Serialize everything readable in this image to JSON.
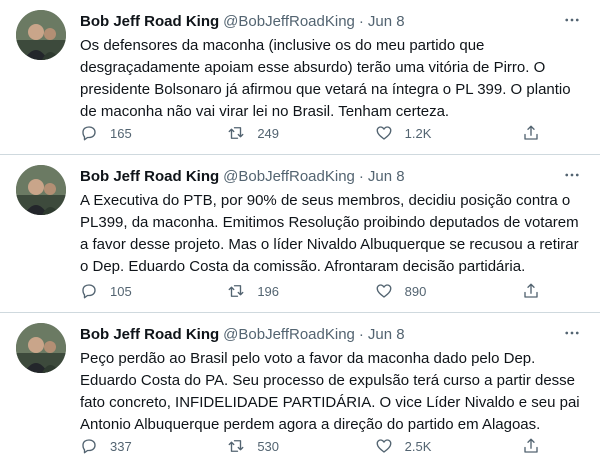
{
  "icons": {
    "more": "more-horizontal-icon",
    "reply": "reply-icon",
    "retweet": "retweet-icon",
    "like": "heart-icon",
    "share": "share-icon"
  },
  "colors": {
    "text": "#0f1419",
    "secondary": "#536471",
    "divider": "#cfd9de"
  },
  "tweets": [
    {
      "name": "Bob Jeff Road King",
      "handle": "@BobJeffRoadKing",
      "separator": "·",
      "date": "Jun 8",
      "lines": [
        "Os defensores da maconha (inclusive os do meu partido que",
        "desgraçadamente apoiam esse absurdo) terão uma vitória de Pirro. O",
        "presidente Bolsonaro já afirmou que vetará na íntegra o PL 399. O plantio",
        "de maconha não vai virar lei no Brasil. Tenham certeza."
      ],
      "replies": "165",
      "retweets": "249",
      "likes": "1.2K"
    },
    {
      "name": "Bob Jeff Road King",
      "handle": "@BobJeffRoadKing",
      "separator": "·",
      "date": "Jun 8",
      "lines": [
        "A Executiva do PTB, por 90% de seus membros, decidiu posição contra o",
        "PL399, da maconha. Emitimos Resolução proibindo deputados de votarem",
        "a favor desse projeto. Mas o líder Nivaldo Albuquerque se recusou a retirar",
        "o Dep. Eduardo Costa da comissão. Afrontaram decisão partidária."
      ],
      "replies": "105",
      "retweets": "196",
      "likes": "890"
    },
    {
      "name": "Bob Jeff Road King",
      "handle": "@BobJeffRoadKing",
      "separator": "·",
      "date": "Jun 8",
      "lines": [
        "Peço perdão ao Brasil pelo voto a favor da maconha dado pelo Dep.",
        "Eduardo Costa do PA. Seu processo de expulsão terá curso a partir desse",
        "fato concreto, INFIDELIDADE PARTIDÁRIA. O vice Líder Nivaldo e seu pai",
        "Antonio Albuquerque perdem agora a direção do partido em Alagoas."
      ],
      "replies": "337",
      "retweets": "530",
      "likes": "2.5K"
    }
  ]
}
